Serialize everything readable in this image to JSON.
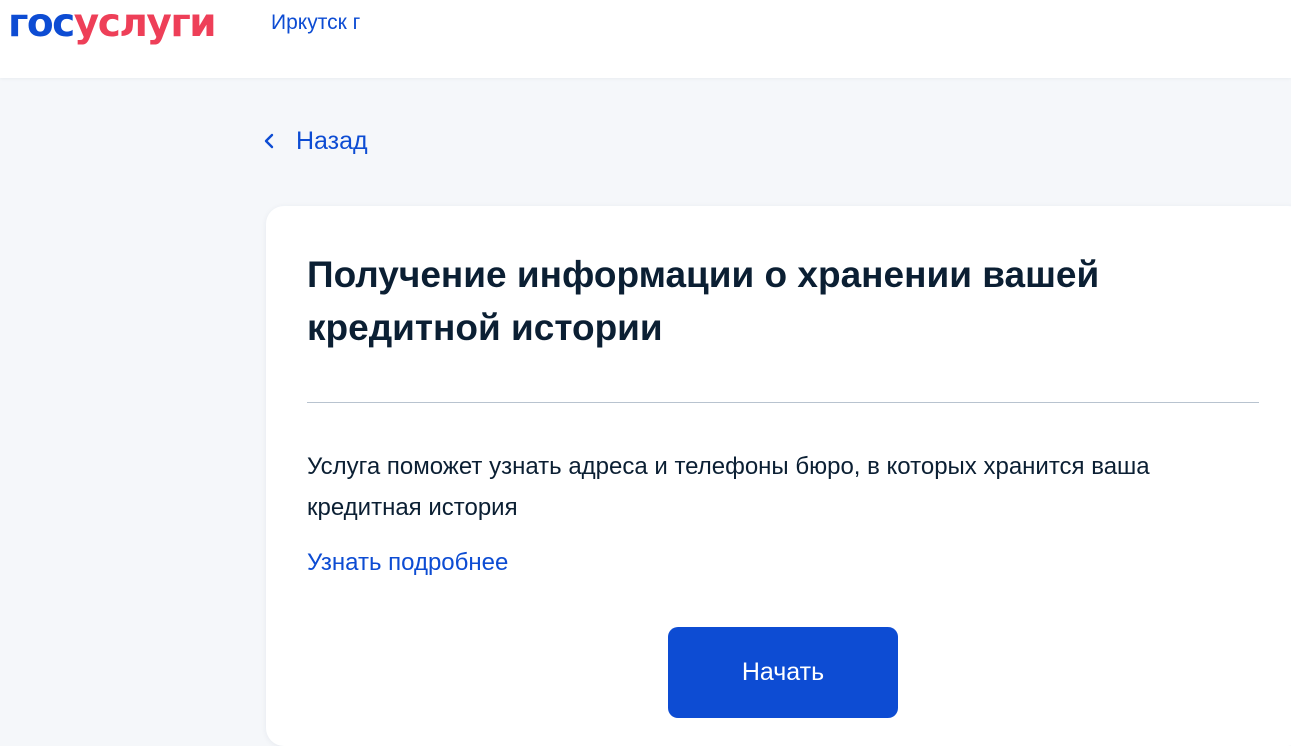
{
  "header": {
    "logo": {
      "part1": "гос",
      "part2": "услуги"
    },
    "city": "Иркутск г"
  },
  "nav": {
    "back_label": "Назад"
  },
  "card": {
    "title": "Получение информации о хранении вашей кредитной истории",
    "description": "Услуга поможет узнать адреса и телефоны бюро, в которых хранится ваша кредитная история",
    "more_link": "Узнать подробнее",
    "start_button": "Начать"
  },
  "icons": {
    "back": "chevron-left-icon"
  },
  "colors": {
    "brand_blue": "#0d4cd3",
    "brand_red": "#ee3f58",
    "text": "#0b1f33",
    "page_bg": "#f5f7fa"
  }
}
